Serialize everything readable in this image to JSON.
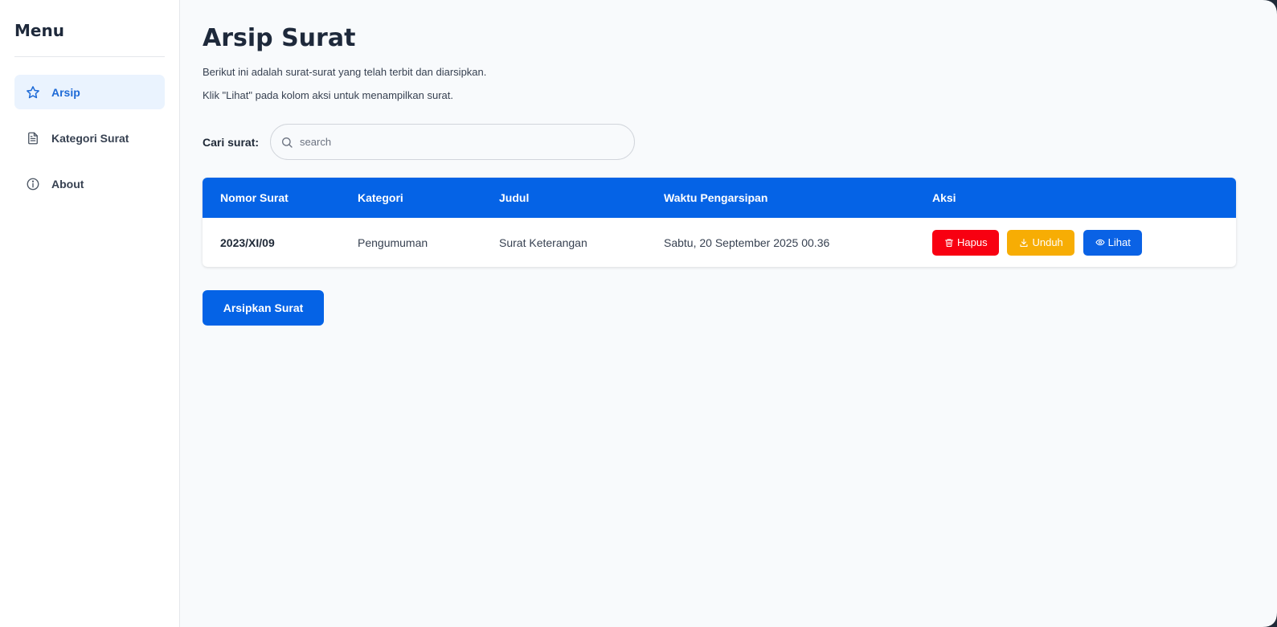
{
  "sidebar": {
    "title": "Menu",
    "items": [
      {
        "label": "Arsip",
        "icon": "star-icon",
        "active": true
      },
      {
        "label": "Kategori Surat",
        "icon": "document-icon",
        "active": false
      },
      {
        "label": "About",
        "icon": "info-icon",
        "active": false
      }
    ]
  },
  "main": {
    "title": "Arsip Surat",
    "subtitle_1": "Berikut ini adalah surat-surat yang telah terbit dan diarsipkan.",
    "subtitle_2": "Klik \"Lihat\" pada kolom aksi untuk menampilkan surat.",
    "search": {
      "label": "Cari surat:",
      "placeholder": "search",
      "value": ""
    },
    "table": {
      "headers": [
        "Nomor Surat",
        "Kategori",
        "Judul",
        "Waktu Pengarsipan",
        "Aksi"
      ],
      "rows": [
        {
          "nomor": "2023/XI/09",
          "kategori": "Pengumuman",
          "judul": "Surat Keterangan",
          "waktu": "Sabtu, 20 September 2025 00.36",
          "actions": {
            "delete": "Hapus",
            "download": "Unduh",
            "view": "Lihat"
          }
        }
      ]
    },
    "primary_button": "Arsipkan Surat"
  },
  "colors": {
    "primary": "#0563e6",
    "danger": "#f80011",
    "warning": "#f7ad04",
    "active_bg": "#eaf3fe",
    "page_bg": "#f8fafc"
  }
}
